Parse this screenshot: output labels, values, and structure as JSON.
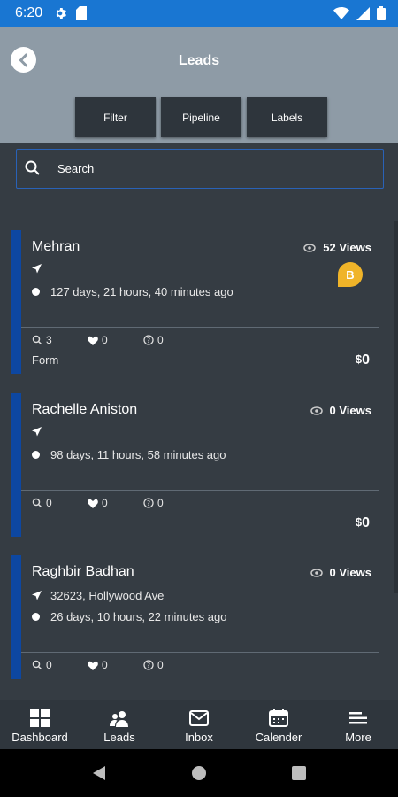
{
  "status_bar": {
    "time": "6:20"
  },
  "header": {
    "title": "Leads",
    "filters": [
      "Filter",
      "Pipeline",
      "Labels"
    ]
  },
  "search": {
    "placeholder": "Search"
  },
  "leads": [
    {
      "name": "Mehran",
      "views_count": "52",
      "views_label": "Views",
      "badge": "B",
      "location": "",
      "time_ago": "127 days, 21 hours, 40 minutes ago",
      "searches": "3",
      "likes": "0",
      "questions": "0",
      "source": "Form",
      "currency": "$",
      "price": "0"
    },
    {
      "name": "Rachelle Aniston",
      "views_count": "0",
      "views_label": "Views",
      "location": "",
      "time_ago": "98 days, 11 hours, 58 minutes ago",
      "searches": "0",
      "likes": "0",
      "questions": "0",
      "source": "",
      "currency": "$",
      "price": "0"
    },
    {
      "name": "Raghbir Badhan",
      "views_count": "0",
      "views_label": "Views",
      "location": "32623, Hollywood Ave",
      "time_ago": "26 days, 10 hours, 22 minutes ago",
      "searches": "0",
      "likes": "0",
      "questions": "0"
    }
  ],
  "bottom_nav": [
    {
      "label": "Dashboard",
      "icon": "dashboard-icon"
    },
    {
      "label": "Leads",
      "icon": "people-icon"
    },
    {
      "label": "Inbox",
      "icon": "mail-icon"
    },
    {
      "label": "Calender",
      "icon": "calendar-icon"
    },
    {
      "label": "More",
      "icon": "menu-icon"
    }
  ],
  "colors": {
    "status_bar": "#1976d2",
    "header": "#8e9ba6",
    "background": "#353c43",
    "accent": "#0d47a1",
    "badge": "#f0b429"
  }
}
